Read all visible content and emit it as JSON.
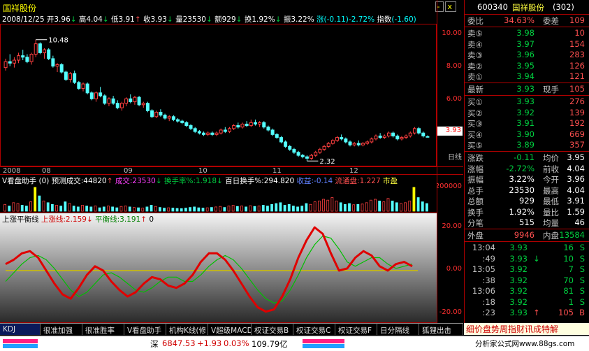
{
  "window": {
    "title": "国祥股份",
    "controls": [
      "-",
      "x"
    ]
  },
  "info_line": {
    "date": "2008/12/25",
    "open_label": "开",
    "open": "3.96",
    "high_label": "高",
    "high": "4.04",
    "low_label": "低",
    "low": "3.91",
    "close_label": "收",
    "close": "3.93",
    "vol_label": "量",
    "vol": "23530",
    "amt_label": "额",
    "amt": "929",
    "turnover_label": "换",
    "turnover": "1.92%",
    "swing_label": "振",
    "swing": "3.22%",
    "change_label": "涨",
    "change": "(-0.11)-2.72%",
    "index_label": "指数",
    "index": "(-1.60)"
  },
  "main_chart": {
    "price_axis": [
      "10.00",
      "8.00",
      "6.00",
      "4.00"
    ],
    "current_price": "3.93",
    "high_mark": "10.48",
    "low_mark": "2.32"
  },
  "chart_data": {
    "type": "candlestick",
    "title": "国祥股份",
    "ylim": [
      2.0,
      11.5
    ],
    "candles": [
      [
        8.6,
        9.2,
        8.4,
        9.0
      ],
      [
        9.0,
        9.5,
        8.7,
        8.9
      ],
      [
        8.9,
        9.3,
        8.6,
        9.1
      ],
      [
        9.1,
        9.6,
        8.9,
        9.4
      ],
      [
        9.4,
        9.8,
        9.1,
        9.3
      ],
      [
        9.3,
        9.5,
        8.9,
        9.0
      ],
      [
        9.0,
        9.6,
        8.8,
        9.5
      ],
      [
        9.5,
        10.48,
        9.3,
        10.2
      ],
      [
        10.2,
        10.3,
        9.5,
        9.6
      ],
      [
        9.6,
        9.9,
        9.2,
        9.8
      ],
      [
        9.8,
        9.9,
        9.1,
        9.2
      ],
      [
        9.2,
        9.4,
        8.6,
        8.7
      ],
      [
        8.7,
        8.9,
        8.3,
        8.8
      ],
      [
        8.8,
        8.9,
        8.2,
        8.3
      ],
      [
        8.3,
        8.4,
        7.7,
        7.8
      ],
      [
        7.8,
        8.3,
        7.6,
        8.2
      ],
      [
        8.2,
        8.4,
        7.5,
        7.6
      ],
      [
        7.6,
        7.7,
        7.1,
        7.2
      ],
      [
        7.2,
        7.6,
        7.0,
        7.5
      ],
      [
        7.5,
        7.6,
        6.8,
        6.9
      ],
      [
        6.9,
        7.0,
        6.4,
        6.5
      ],
      [
        6.5,
        7.0,
        6.3,
        6.9
      ],
      [
        6.9,
        7.3,
        6.6,
        6.7
      ],
      [
        6.7,
        6.8,
        6.1,
        6.2
      ],
      [
        6.2,
        6.6,
        6.0,
        6.5
      ],
      [
        6.5,
        6.7,
        6.1,
        6.2
      ],
      [
        6.2,
        6.4,
        5.8,
        5.9
      ],
      [
        5.9,
        6.3,
        5.7,
        6.2
      ],
      [
        6.2,
        6.6,
        6.0,
        6.5
      ],
      [
        6.5,
        6.8,
        6.2,
        6.3
      ],
      [
        6.3,
        6.7,
        6.1,
        6.6
      ],
      [
        6.6,
        6.7,
        6.0,
        6.1
      ],
      [
        6.1,
        6.3,
        5.9,
        6.2
      ],
      [
        6.2,
        6.3,
        5.6,
        5.7
      ],
      [
        5.7,
        5.8,
        5.2,
        5.3
      ],
      [
        5.3,
        5.7,
        5.2,
        5.6
      ],
      [
        5.6,
        5.8,
        5.3,
        5.4
      ],
      [
        5.4,
        5.5,
        5.1,
        5.2
      ],
      [
        5.2,
        5.4,
        5.0,
        5.3
      ],
      [
        5.3,
        5.4,
        5.0,
        5.1
      ],
      [
        5.1,
        5.2,
        4.9,
        5.0
      ],
      [
        5.0,
        5.1,
        4.8,
        4.9
      ],
      [
        4.9,
        5.0,
        4.6,
        4.7
      ],
      [
        4.7,
        4.8,
        4.4,
        4.5
      ],
      [
        4.5,
        4.6,
        4.2,
        4.3
      ],
      [
        4.3,
        4.4,
        4.1,
        4.2
      ],
      [
        4.2,
        4.3,
        4.0,
        4.1
      ],
      [
        4.1,
        4.3,
        4.0,
        4.2
      ],
      [
        4.2,
        4.3,
        4.0,
        4.1
      ],
      [
        4.1,
        4.3,
        4.0,
        4.2
      ],
      [
        4.2,
        4.5,
        4.1,
        4.4
      ],
      [
        4.4,
        4.6,
        4.2,
        4.3
      ],
      [
        4.3,
        4.6,
        4.2,
        4.5
      ],
      [
        4.5,
        4.8,
        4.4,
        4.7
      ],
      [
        4.7,
        4.9,
        4.5,
        4.6
      ],
      [
        4.6,
        4.9,
        4.5,
        4.8
      ],
      [
        4.8,
        5.0,
        4.6,
        4.7
      ],
      [
        4.7,
        5.1,
        4.6,
        4.9
      ],
      [
        4.9,
        5.1,
        4.7,
        4.8
      ],
      [
        4.8,
        5.0,
        4.6,
        4.9
      ],
      [
        4.9,
        5.0,
        4.5,
        4.6
      ],
      [
        4.6,
        4.7,
        4.3,
        4.4
      ],
      [
        4.4,
        4.5,
        4.0,
        4.1
      ],
      [
        4.1,
        4.2,
        3.8,
        3.9
      ],
      [
        3.9,
        4.0,
        3.5,
        3.6
      ],
      [
        3.6,
        3.7,
        3.2,
        3.3
      ],
      [
        3.3,
        3.4,
        3.0,
        3.1
      ],
      [
        3.1,
        3.2,
        2.8,
        2.9
      ],
      [
        2.9,
        3.0,
        2.6,
        2.7
      ],
      [
        2.7,
        2.8,
        2.5,
        2.6
      ],
      [
        2.6,
        2.7,
        2.32,
        2.5
      ],
      [
        2.5,
        2.8,
        2.4,
        2.7
      ],
      [
        2.7,
        3.0,
        2.6,
        2.9
      ],
      [
        2.9,
        3.2,
        2.8,
        3.1
      ],
      [
        3.1,
        3.4,
        3.0,
        3.3
      ],
      [
        3.3,
        3.6,
        3.2,
        3.5
      ],
      [
        3.5,
        3.8,
        3.4,
        3.7
      ],
      [
        3.7,
        4.0,
        3.6,
        3.9
      ],
      [
        3.9,
        4.1,
        3.7,
        3.8
      ],
      [
        3.8,
        3.9,
        3.5,
        3.6
      ],
      [
        3.6,
        3.7,
        3.3,
        3.4
      ],
      [
        3.4,
        3.6,
        3.3,
        3.5
      ],
      [
        3.5,
        3.7,
        3.3,
        3.4
      ],
      [
        3.4,
        3.6,
        3.3,
        3.5
      ],
      [
        3.5,
        3.7,
        3.4,
        3.6
      ],
      [
        3.6,
        3.9,
        3.5,
        3.8
      ],
      [
        3.8,
        4.1,
        3.7,
        4.0
      ],
      [
        4.0,
        4.2,
        3.8,
        3.9
      ],
      [
        3.9,
        4.1,
        3.8,
        4.0
      ],
      [
        4.0,
        4.3,
        3.9,
        4.2
      ],
      [
        4.2,
        4.3,
        3.9,
        4.0
      ],
      [
        4.0,
        4.1,
        3.7,
        3.8
      ],
      [
        3.8,
        4.0,
        3.7,
        3.9
      ],
      [
        3.9,
        4.1,
        3.8,
        4.0
      ],
      [
        4.0,
        4.3,
        3.9,
        4.2
      ],
      [
        4.2,
        4.6,
        4.1,
        4.5
      ],
      [
        4.5,
        4.6,
        4.1,
        4.2
      ],
      [
        4.2,
        4.3,
        3.9,
        4.0
      ],
      [
        3.96,
        4.04,
        3.91,
        3.93
      ]
    ],
    "volumes": [
      40,
      30,
      50,
      45,
      35,
      30,
      55,
      140,
      90,
      60,
      50,
      40,
      35,
      30,
      55,
      45,
      30,
      25,
      35,
      30,
      25,
      30,
      20,
      25,
      30,
      25,
      20,
      28,
      30,
      25,
      22,
      20,
      18,
      25,
      35,
      28,
      22,
      18,
      20,
      18,
      16,
      15,
      18,
      22,
      25,
      20,
      18,
      20,
      22,
      25,
      28,
      22,
      30,
      35,
      28,
      30,
      25,
      32,
      28,
      30,
      35,
      30,
      40,
      45,
      50,
      35,
      40,
      30,
      25,
      30,
      45,
      40,
      55,
      60,
      70,
      65,
      80,
      60,
      50,
      40,
      45,
      38,
      40,
      42,
      50,
      65,
      70,
      60,
      55,
      75,
      60,
      50,
      45,
      50,
      60,
      140,
      80,
      55,
      45
    ],
    "indicator_upline": [
      3,
      5,
      8,
      9,
      6,
      0,
      -6,
      -11,
      -13,
      -8,
      -2,
      2,
      0,
      -5,
      -9,
      -12,
      -10,
      -6,
      -3,
      -4,
      -7,
      -8,
      -6,
      -2,
      4,
      8,
      8,
      5,
      0,
      -6,
      -12,
      -17,
      -19,
      -18,
      -12,
      -4,
      6,
      14,
      20,
      17,
      8,
      0,
      1,
      6,
      9,
      7,
      2,
      0,
      3,
      4,
      2
    ],
    "indicator_balance": [
      -5,
      -1,
      3,
      6,
      7,
      5,
      1,
      -4,
      -9,
      -12,
      -10,
      -6,
      -2,
      -1,
      -3,
      -6,
      -9,
      -10,
      -8,
      -5,
      -3,
      -3,
      -5,
      -5,
      -2,
      2,
      5,
      7,
      5,
      1,
      -4,
      -9,
      -13,
      -15,
      -14,
      -9,
      -2,
      6,
      12,
      16,
      15,
      10,
      4,
      2,
      4,
      6,
      6,
      3,
      1,
      2,
      3
    ],
    "indicator_ylim": [
      -22,
      22
    ]
  },
  "date_axis": [
    "2008",
    "08",
    "09",
    "10",
    "11",
    "12"
  ],
  "period_label": "日线",
  "volume_panel": {
    "title": "V看盘助手 (0)",
    "forecast_label": "预测成交:",
    "forecast": "44820",
    "vol_label": "成交:",
    "vol": "23530",
    "turnover_label": "换手率%:",
    "turnover": "1.918",
    "hundred_label": "百日换手%:",
    "hundred": "294.820",
    "gain_label": "收益:",
    "gain": "-0.14",
    "float_label": "流通盘:",
    "float": "1.227",
    "market_label": "市盈",
    "axis": [
      "200000",
      "100000"
    ]
  },
  "indicator_panel": {
    "title": "上涨平衡线",
    "up_label": "上涨线:",
    "up": "2.159",
    "bal_label": "平衡线:",
    "bal": "3.191",
    "zero": "0",
    "axis": [
      "20.00",
      "0.00",
      "-20.00"
    ]
  },
  "tabs": [
    "KDJ",
    "很准加强",
    "很准胜率",
    "V看盘助手",
    "机构K线(修",
    "V超级MACD",
    "权证交易B",
    "权证交易C",
    "权证交易F",
    "日分隔线",
    "狐狸出击"
  ],
  "quote": {
    "code": "600340",
    "name": "国祥股份",
    "num": "(302)",
    "weibi_label": "委比",
    "weibi": "34.63%",
    "weicha_label": "委差",
    "weicha": "109",
    "asks": [
      {
        "label": "卖⑤",
        "price": "3.98",
        "vol": "10"
      },
      {
        "label": "卖④",
        "price": "3.97",
        "vol": "154"
      },
      {
        "label": "卖③",
        "price": "3.96",
        "vol": "283"
      },
      {
        "label": "卖②",
        "price": "3.95",
        "vol": "126"
      },
      {
        "label": "卖①",
        "price": "3.94",
        "vol": "121"
      }
    ],
    "last_label": "最新",
    "last": "3.93",
    "now_label": "现手",
    "now": "105",
    "bids": [
      {
        "label": "买①",
        "price": "3.93",
        "vol": "276"
      },
      {
        "label": "买②",
        "price": "3.92",
        "vol": "139"
      },
      {
        "label": "买③",
        "price": "3.91",
        "vol": "192"
      },
      {
        "label": "买④",
        "price": "3.90",
        "vol": "669"
      },
      {
        "label": "买⑤",
        "price": "3.89",
        "vol": "357"
      }
    ],
    "stats": [
      {
        "l1": "涨跌",
        "v1": "-0.11",
        "l2": "均价",
        "v2": "3.95"
      },
      {
        "l1": "涨幅",
        "v1": "-2.72%",
        "l2": "前收",
        "v2": "4.04"
      },
      {
        "l1": "振幅",
        "v1": "3.22%",
        "l2": "今开",
        "v2": "3.96"
      },
      {
        "l1": "总手",
        "v1": "23530",
        "l2": "最高",
        "v2": "4.04"
      },
      {
        "l1": "总额",
        "v1": "929",
        "l2": "最低",
        "v2": "3.91"
      },
      {
        "l1": "换手",
        "v1": "1.92%",
        "l2": "量比",
        "v2": "1.59"
      },
      {
        "l1": "分笔",
        "v1": "515",
        "l2": "均量",
        "v2": "46"
      }
    ],
    "outer_label": "外盘",
    "outer": "9946",
    "inner_label": "内盘",
    "inner": "13584",
    "ticks": [
      {
        "t": "13:04",
        "p": "3.93",
        "a": "",
        "v": "16",
        "s": "S"
      },
      {
        "t": ":49",
        "p": "3.93",
        "a": "↓",
        "v": "10",
        "s": "S"
      },
      {
        "t": "13:05",
        "p": "3.92",
        "a": "",
        "v": "7",
        "s": "S"
      },
      {
        "t": ":38",
        "p": "3.92",
        "a": "",
        "v": "70",
        "s": "S"
      },
      {
        "t": "13:06",
        "p": "3.92",
        "a": "",
        "v": "81",
        "s": "S"
      },
      {
        "t": ":18",
        "p": "3.92",
        "a": "",
        "v": "1",
        "s": "S"
      },
      {
        "t": ":23",
        "p": "3.93",
        "a": "↑",
        "v": "105",
        "s": "B"
      }
    ],
    "bottom_menu": "细价盘势周指财讯成特解"
  },
  "status": {
    "market": "深",
    "index": "6847.53",
    "change": "+1.93",
    "pct": "0.03%",
    "amount": "109.79亿",
    "watermark": "分析家公式网www.88gs.com"
  }
}
